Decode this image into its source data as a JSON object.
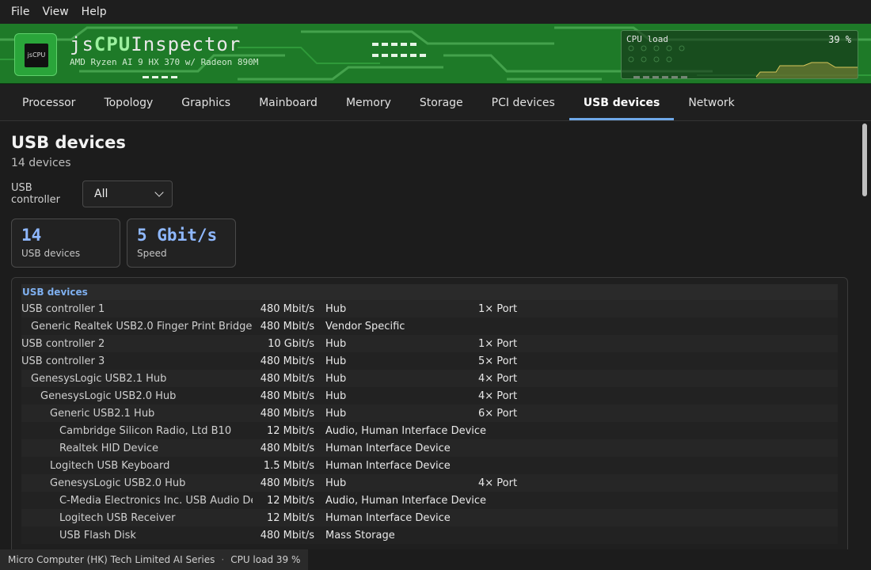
{
  "menu": [
    "File",
    "View",
    "Help"
  ],
  "header": {
    "title_prefix": "js",
    "title_accent": "CPU",
    "title_suffix": "Inspector",
    "subtitle": "AMD Ryzen AI 9 HX 370 w/ Radeon 890M",
    "logo_chip_text": "jsCPU",
    "cpu_widget": {
      "label": "CPU load",
      "value": "39 %",
      "load_fraction": 0.39
    }
  },
  "tabs": [
    "Processor",
    "Topology",
    "Graphics",
    "Mainboard",
    "Memory",
    "Storage",
    "PCI devices",
    "USB devices",
    "Network"
  ],
  "active_tab": "USB devices",
  "page": {
    "title": "USB devices",
    "count": "14 devices",
    "filter_label": "USB controller",
    "filter_value": "All",
    "stats": [
      {
        "value": "14",
        "caption": "USB devices"
      },
      {
        "value": "5 Gbit/s",
        "caption": "Speed"
      }
    ]
  },
  "table": {
    "header": "USB devices",
    "rows": [
      {
        "name": "USB controller 1",
        "level": 0,
        "speed": "480 Mbit/s",
        "class": "Hub",
        "ports": "1× Port"
      },
      {
        "name": "Generic Realtek USB2.0 Finger Print Bridge",
        "level": 1,
        "speed": "480 Mbit/s",
        "class": "Vendor Specific",
        "ports": ""
      },
      {
        "name": "USB controller 2",
        "level": 0,
        "speed": "10 Gbit/s",
        "class": "Hub",
        "ports": "1× Port"
      },
      {
        "name": "USB controller 3",
        "level": 0,
        "speed": "480 Mbit/s",
        "class": "Hub",
        "ports": "5× Port"
      },
      {
        "name": "GenesysLogic USB2.1 Hub",
        "level": 1,
        "speed": "480 Mbit/s",
        "class": "Hub",
        "ports": "4× Port"
      },
      {
        "name": "GenesysLogic USB2.0 Hub",
        "level": 2,
        "speed": "480 Mbit/s",
        "class": "Hub",
        "ports": "4× Port"
      },
      {
        "name": "Generic USB2.1 Hub",
        "level": 3,
        "speed": "480 Mbit/s",
        "class": "Hub",
        "ports": "6× Port"
      },
      {
        "name": "Cambridge Silicon Radio, Ltd B10",
        "level": 4,
        "speed": "12 Mbit/s",
        "class": "Audio, Human Interface Device",
        "ports": ""
      },
      {
        "name": "Realtek HID Device",
        "level": 4,
        "speed": "480 Mbit/s",
        "class": "Human Interface Device",
        "ports": ""
      },
      {
        "name": "Logitech USB Keyboard",
        "level": 3,
        "speed": "1.5 Mbit/s",
        "class": "Human Interface Device",
        "ports": ""
      },
      {
        "name": "GenesysLogic USB2.0 Hub",
        "level": 3,
        "speed": "480 Mbit/s",
        "class": "Hub",
        "ports": "4× Port"
      },
      {
        "name": "C-Media Electronics Inc. USB Audio Device",
        "level": 4,
        "speed": "12 Mbit/s",
        "class": "Audio, Human Interface Device",
        "ports": ""
      },
      {
        "name": "Logitech USB Receiver",
        "level": 4,
        "speed": "12 Mbit/s",
        "class": "Human Interface Device",
        "ports": ""
      },
      {
        "name": "USB Flash Disk",
        "level": 4,
        "speed": "480 Mbit/s",
        "class": "Mass Storage",
        "ports": ""
      }
    ]
  },
  "status": {
    "vendor": "Micro Computer (HK) Tech Limited AI Series",
    "separator": "·",
    "cpu": "CPU load 39 %"
  }
}
